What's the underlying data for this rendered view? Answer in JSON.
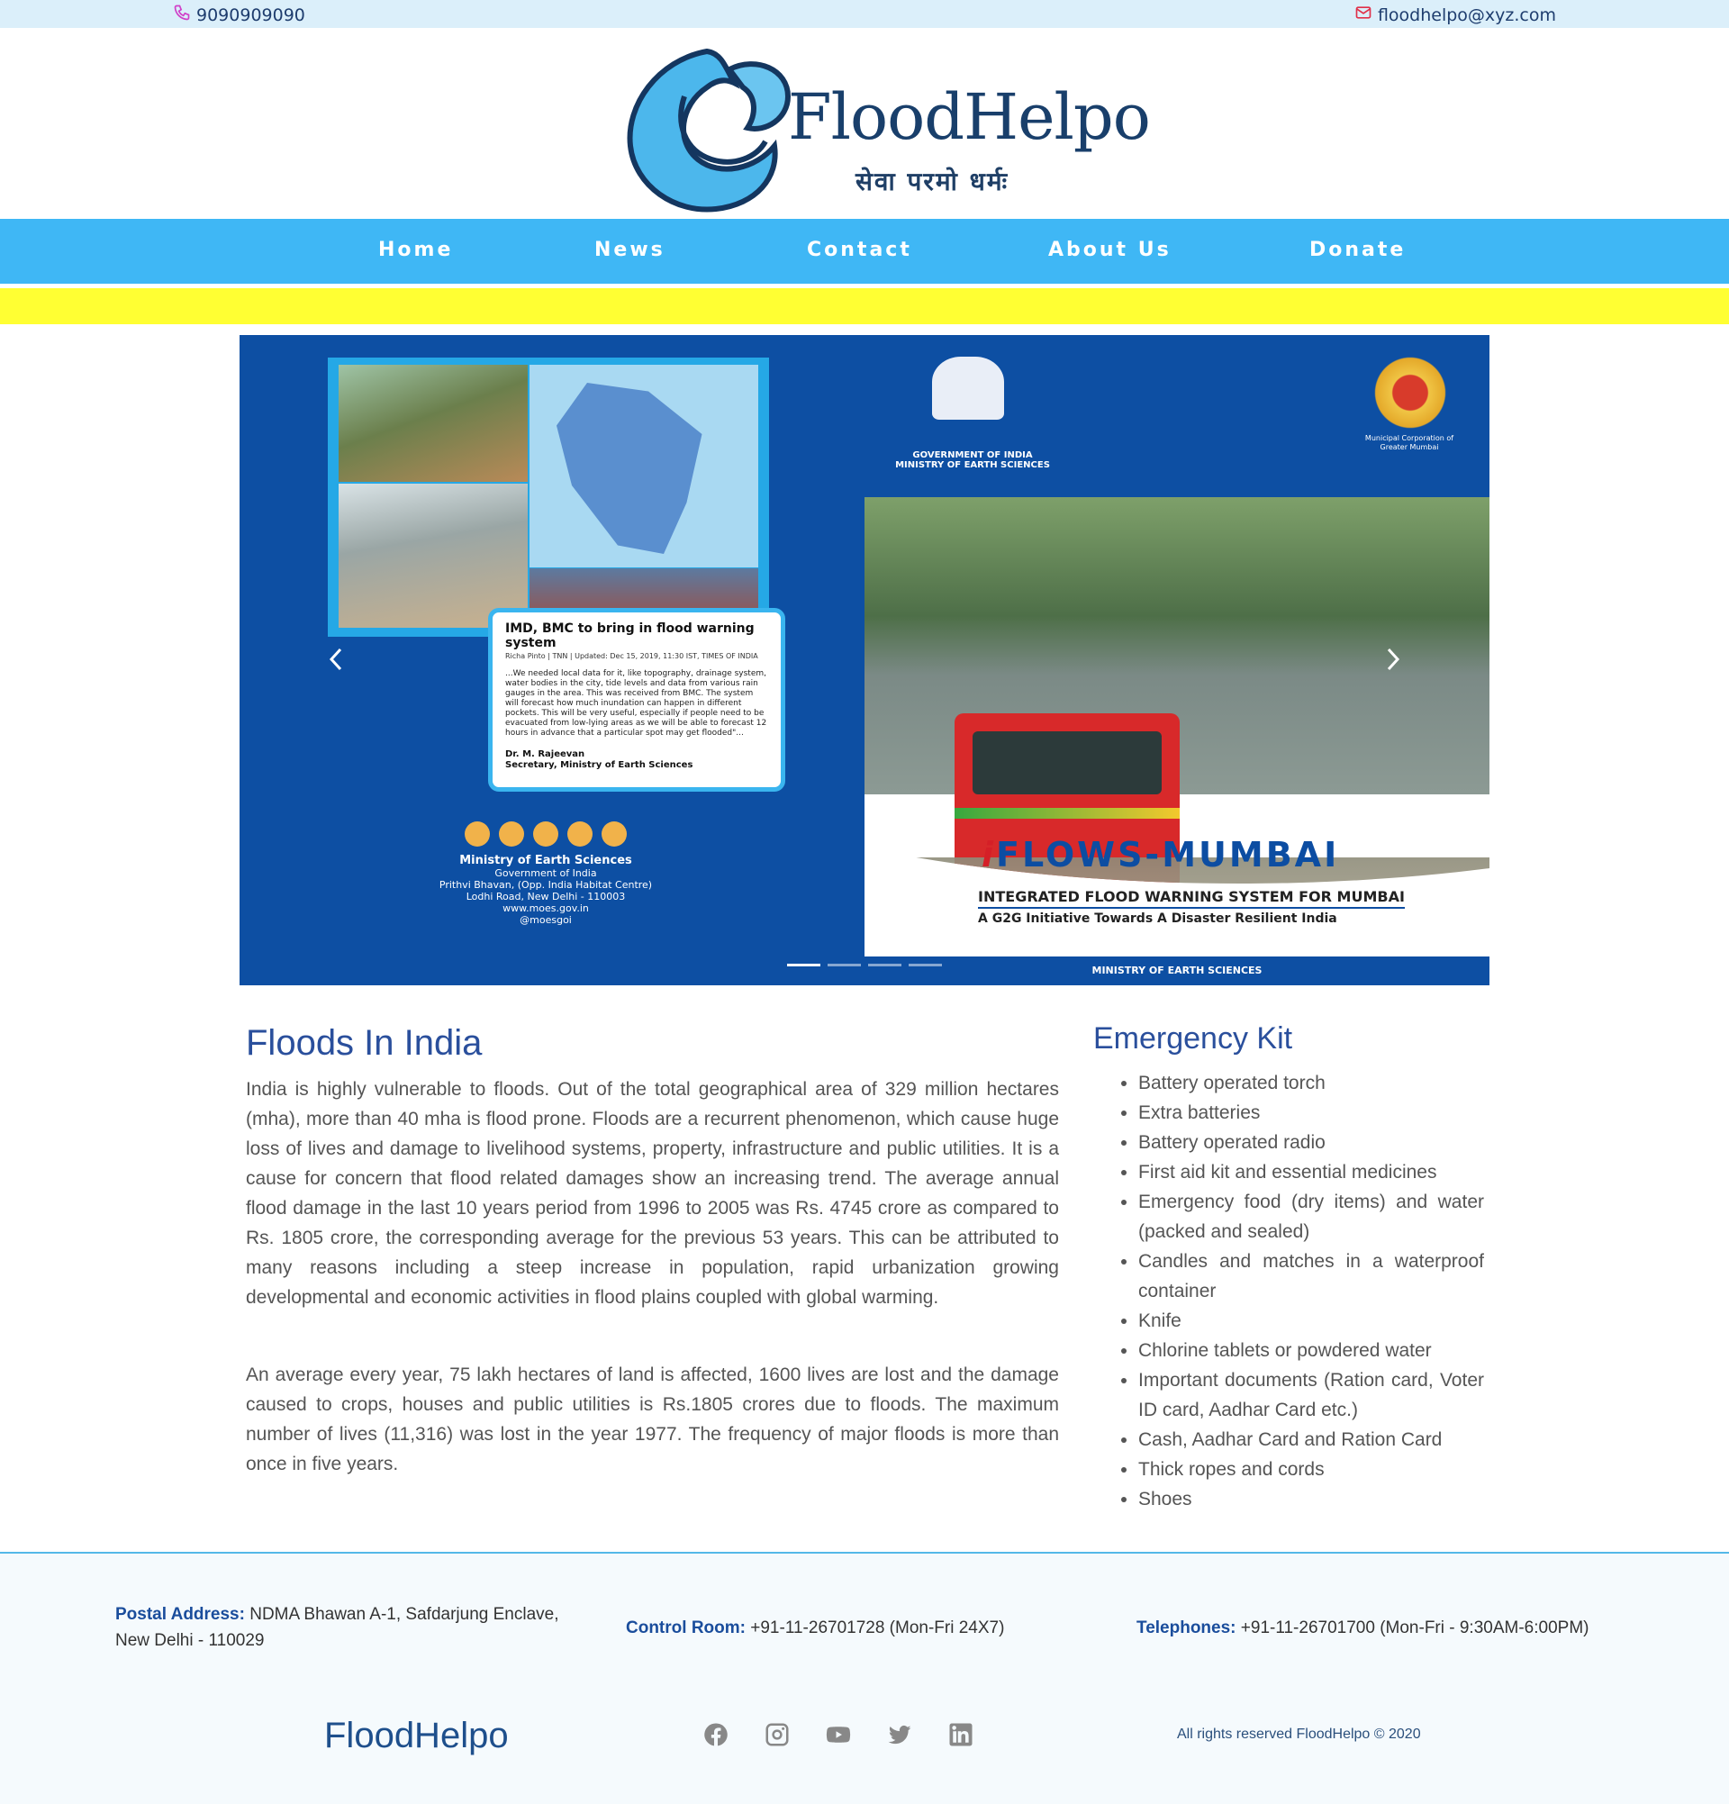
{
  "topbar": {
    "phone": "9090909090",
    "email": "floodhelpo@xyz.com"
  },
  "header": {
    "brand": "FloodHelpo",
    "tagline": "सेवा  परमो  धर्मः"
  },
  "nav": {
    "items": [
      {
        "label": "Home"
      },
      {
        "label": "News"
      },
      {
        "label": "Contact"
      },
      {
        "label": "About Us"
      },
      {
        "label": "Donate"
      }
    ]
  },
  "carousel": {
    "news_title": "IMD, BMC to bring in flood warning system",
    "news_meta": "Richa Pinto | TNN | Updated: Dec 15, 2019, 11:30 IST, TIMES OF INDIA",
    "news_body": "...We needed local data for it, like topography, drainage system, water bodies in the city, tide levels and data from various rain gauges in the area. This was received from BMC. The system will forecast how much inundation can happen in different pockets. This will be very useful, especially if people need to be evacuated from low-lying areas as we will be able to forecast 12 hours in advance that a particular spot may get flooded\"...",
    "news_sign_name": "Dr. M. Rajeevan",
    "news_sign_role": "Secretary, Ministry of Earth Sciences",
    "moes_name": "Ministry of Earth Sciences",
    "moes_line1": "Government of India",
    "moes_line2": "Prithvi Bhavan, (Opp. India Habitat Centre)",
    "moes_line3": "Lodhi Road, New Delhi - 110003",
    "moes_line4": "www.moes.gov.in",
    "moes_social": "@moesgoi",
    "gov_line1": "GOVERNMENT OF INDIA",
    "gov_line2": "MINISTRY OF EARTH SCIENCES",
    "bmc_line": "Municipal Corporation of Greater Mumbai",
    "iflows_i": "i",
    "iflows_rest": "FLOWS-MUMBAI",
    "iflows_sub1": "INTEGRATED FLOOD WARNING SYSTEM FOR MUMBAI",
    "iflows_sub2": "A G2G Initiative Towards A Disaster Resilient India",
    "panel_footer": "MINISTRY OF EARTH SCIENCES",
    "active_slide": 1,
    "slide_count": 4
  },
  "floods": {
    "title": "Floods In India",
    "p1": "India is highly vulnerable to floods. Out of the total geographical area of 329 million hectares (mha), more than 40 mha is flood prone. Floods are a recurrent phenomenon, which cause huge loss of lives and damage to livelihood systems, property, infrastructure and public utilities. It is a cause for concern that flood related damages show an increasing trend. The average annual flood damage in the last 10 years period from 1996 to 2005 was Rs. 4745 crore as compared to Rs. 1805 crore, the corresponding average for the previous 53 years. This can be attributed to many reasons including a steep increase in population, rapid urbanization growing developmental and economic activities in flood plains coupled with global warming.",
    "p2": "An average every year, 75 lakh hectares of land is affected, 1600 lives are lost and the damage caused to crops, houses and public utilities is Rs.1805 crores due to floods. The maximum number of lives (11,316) was lost in the year 1977. The frequency of major floods is more than once in five years."
  },
  "kit": {
    "title": "Emergency Kit",
    "items": [
      "Battery operated torch",
      "Extra batteries",
      "Battery operated radio",
      "First aid kit and essential medicines",
      "Emergency food (dry items) and water (packed and sealed)",
      "Candles and matches in a waterproof container",
      "Knife",
      "Chlorine tablets or powdered water",
      "Important documents (Ration card, Voter ID card, Aadhar Card etc.)",
      "Cash, Aadhar Card and Ration Card",
      "Thick ropes and cords",
      "Shoes"
    ]
  },
  "footer": {
    "postal_label": "Postal Address:",
    "postal_value": " NDMA Bhawan A-1, Safdarjung Enclave, New Delhi - 110029",
    "control_label": "Control Room:",
    "control_value": " +91-11-26701728 (Mon-Fri 24X7)",
    "tel_label": "Telephones:",
    "tel_value": " +91-11-26701700 (Mon-Fri - 9:30AM-6:00PM)",
    "brand": "FloodHelpo",
    "socials": [
      "facebook-icon",
      "instagram-icon",
      "youtube-icon",
      "twitter-icon",
      "linkedin-icon"
    ],
    "rights": "All rights reserved FloodHelpo © 2020"
  },
  "colors": {
    "nav": "#3fb7f5",
    "yellow_band": "#ffff33",
    "heading": "#2a4f9c",
    "carousel_bg": "#0d4fa3"
  }
}
